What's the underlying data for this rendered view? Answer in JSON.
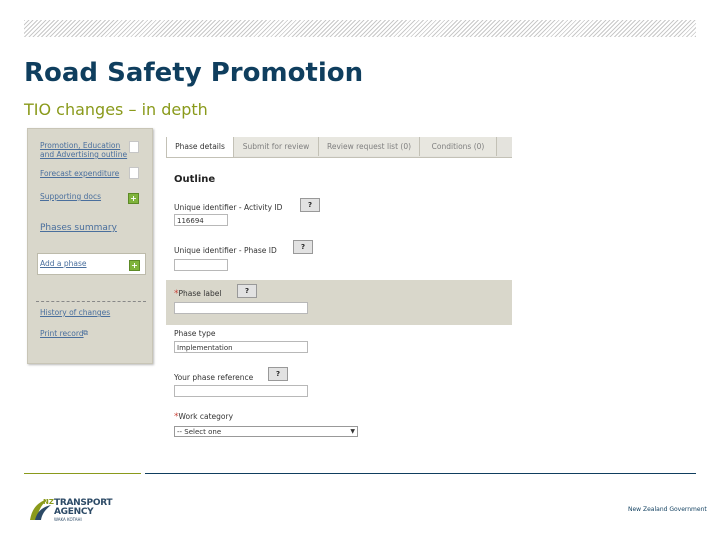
{
  "slide": {
    "title": "Road Safety Promotion",
    "subtitle": "TIO changes – in depth"
  },
  "sidebar": {
    "items": [
      {
        "label": "Promotion, Education and Advertising outline",
        "icon": "document-icon"
      },
      {
        "label": "Forecast expenditure",
        "icon": "document-icon"
      },
      {
        "label": "Supporting docs",
        "icon": "plus-icon"
      }
    ],
    "phases_summary": "Phases summary",
    "add_phase": "Add a phase",
    "history": "History of changes",
    "print_record": "Print record"
  },
  "tabs": [
    {
      "label": "Phase details",
      "active": true
    },
    {
      "label": "Submit for review",
      "active": false
    },
    {
      "label": "Review request list (0)",
      "active": false
    },
    {
      "label": "Conditions (0)",
      "active": false
    }
  ],
  "form": {
    "heading": "Outline",
    "help_label": "?",
    "required_marker": "*",
    "fields": {
      "activity_id": {
        "label": "Unique identifier - Activity ID",
        "value": "116694"
      },
      "phase_id": {
        "label": "Unique identifier - Phase ID",
        "value": ""
      },
      "phase_label": {
        "label": "Phase label",
        "value": "",
        "required": true
      },
      "phase_type": {
        "label": "Phase type",
        "value": "Implementation"
      },
      "phase_reference": {
        "label": "Your phase reference",
        "value": ""
      },
      "work_category": {
        "label": "Work category",
        "value": "-- Select one",
        "required": true
      }
    }
  },
  "footer": {
    "logo_line1": "TRANSPORT",
    "logo_line2": "AGENCY",
    "logo_line3": "WAKA KOTAHI",
    "logo_prefix": "NZ",
    "government": "New Zealand Government"
  },
  "colors": {
    "title": "#0f3e5e",
    "subtitle": "#8a9a1b",
    "panel": "#d9d7cb"
  }
}
